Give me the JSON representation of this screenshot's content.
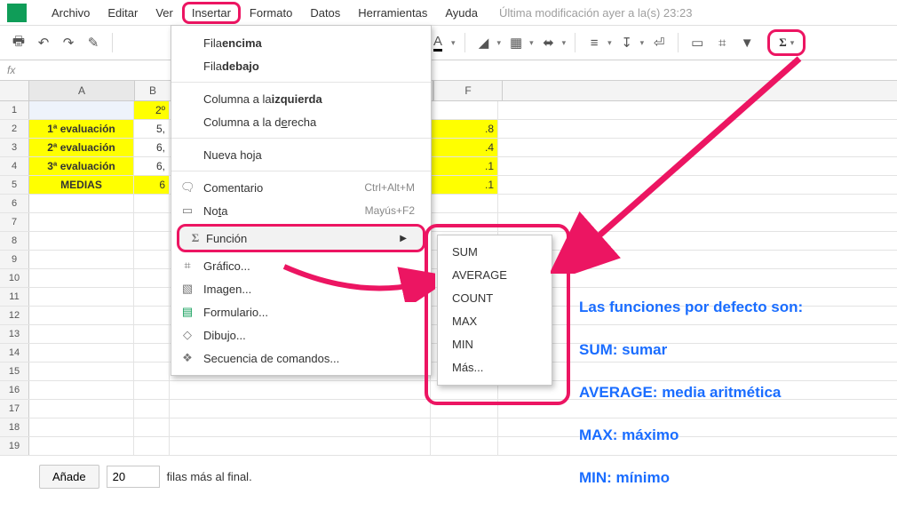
{
  "menubar": {
    "items": [
      "Archivo",
      "Editar",
      "Ver",
      "Insertar",
      "Formato",
      "Datos",
      "Herramientas",
      "Ayuda"
    ],
    "last_modified": "Última modificación ayer a la(s) 23:23"
  },
  "fx_label": "fx",
  "columns": {
    "A": "A",
    "B": "B",
    "F": "F"
  },
  "rows": [
    {
      "n": "1",
      "A": "",
      "B": "2º",
      "F": ""
    },
    {
      "n": "2",
      "A": "1ª evaluación",
      "B": "5,",
      "F": ".8"
    },
    {
      "n": "3",
      "A": "2ª evaluación",
      "B": "6,",
      "F": ".4"
    },
    {
      "n": "4",
      "A": "3ª evaluación",
      "B": "6,",
      "F": ".1"
    },
    {
      "n": "5",
      "A": "MEDIAS",
      "B": "6",
      "F": ".1"
    },
    {
      "n": "6",
      "A": "",
      "B": "",
      "F": ""
    },
    {
      "n": "7",
      "A": "",
      "B": "",
      "F": ""
    },
    {
      "n": "8",
      "A": "",
      "B": "",
      "F": ""
    },
    {
      "n": "9",
      "A": "",
      "B": "",
      "F": ""
    },
    {
      "n": "10",
      "A": "",
      "B": "",
      "F": ""
    },
    {
      "n": "11",
      "A": "",
      "B": "",
      "F": ""
    },
    {
      "n": "12",
      "A": "",
      "B": "",
      "F": ""
    },
    {
      "n": "13",
      "A": "",
      "B": "",
      "F": ""
    },
    {
      "n": "14",
      "A": "",
      "B": "",
      "F": ""
    },
    {
      "n": "15",
      "A": "",
      "B": "",
      "F": ""
    },
    {
      "n": "16",
      "A": "",
      "B": "",
      "F": ""
    },
    {
      "n": "17",
      "A": "",
      "B": "",
      "F": ""
    },
    {
      "n": "18",
      "A": "",
      "B": "",
      "F": ""
    },
    {
      "n": "19",
      "A": "",
      "B": "",
      "F": ""
    }
  ],
  "addrow": {
    "button": "Añade",
    "value": "20",
    "suffix": "filas más al final."
  },
  "menu": {
    "row_above_pre": "Fila ",
    "row_above_b": "encima",
    "row_below_pre": "Fila ",
    "row_below_b": "debajo",
    "col_left_pre": "Columna a la ",
    "col_left_b": "izquierda",
    "col_right_pre": "Columna a la d",
    "col_right_u": "e",
    "col_right_post": "recha",
    "new_sheet": "Nueva hoja",
    "comment": "Comentario",
    "comment_sc": "Ctrl+Alt+M",
    "note_pre": "No",
    "note_u": "t",
    "note_post": "a",
    "note_sc": "Mayús+F2",
    "function": "Función",
    "chart": "Gráfico...",
    "image": "Imagen...",
    "form": "Formulario...",
    "drawing": "Dibujo...",
    "script": "Secuencia de comandos..."
  },
  "submenu": [
    "SUM",
    "AVERAGE",
    "COUNT",
    "MAX",
    "MIN",
    "Más..."
  ],
  "sigma": "Σ",
  "icons": {
    "comment": "🗨",
    "note": "▭",
    "chart": "⌗",
    "image": "▧",
    "form": "▤",
    "drawing": "◇",
    "script": "❖"
  },
  "annotations": {
    "title": "Las funciones por defecto son:",
    "sum": "SUM: sumar",
    "avg": "AVERAGE: media aritmética",
    "max": "MAX: máximo",
    "min": "MIN: mínimo"
  }
}
